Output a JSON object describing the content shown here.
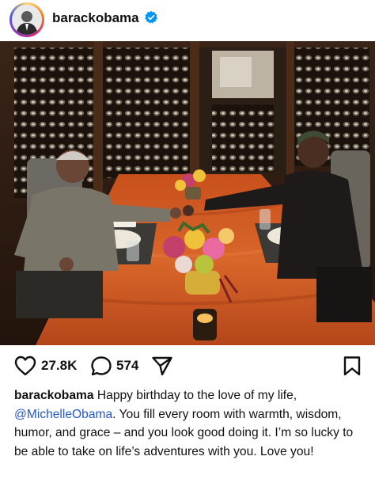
{
  "post": {
    "username": "barackobama",
    "verified": true,
    "likes": "27.8K",
    "comments": "574"
  },
  "caption": {
    "username": "barackobama",
    "text_before": " Happy birthday to the love of my life, ",
    "mention": "@MichelleObama",
    "text_after": ". You fill every room with warmth, wisdom, humor, and grace – and you look good doing it. I’m so lucky to be able to take on life’s adventures with you. Love you!"
  },
  "icons": {
    "verified": "verified-badge-icon",
    "like": "heart-icon",
    "comment": "comment-bubble-icon",
    "share": "paper-plane-icon",
    "save": "bookmark-icon"
  },
  "colors": {
    "verified": "#0095f6",
    "mention": "#2459c8",
    "text": "#111111"
  }
}
